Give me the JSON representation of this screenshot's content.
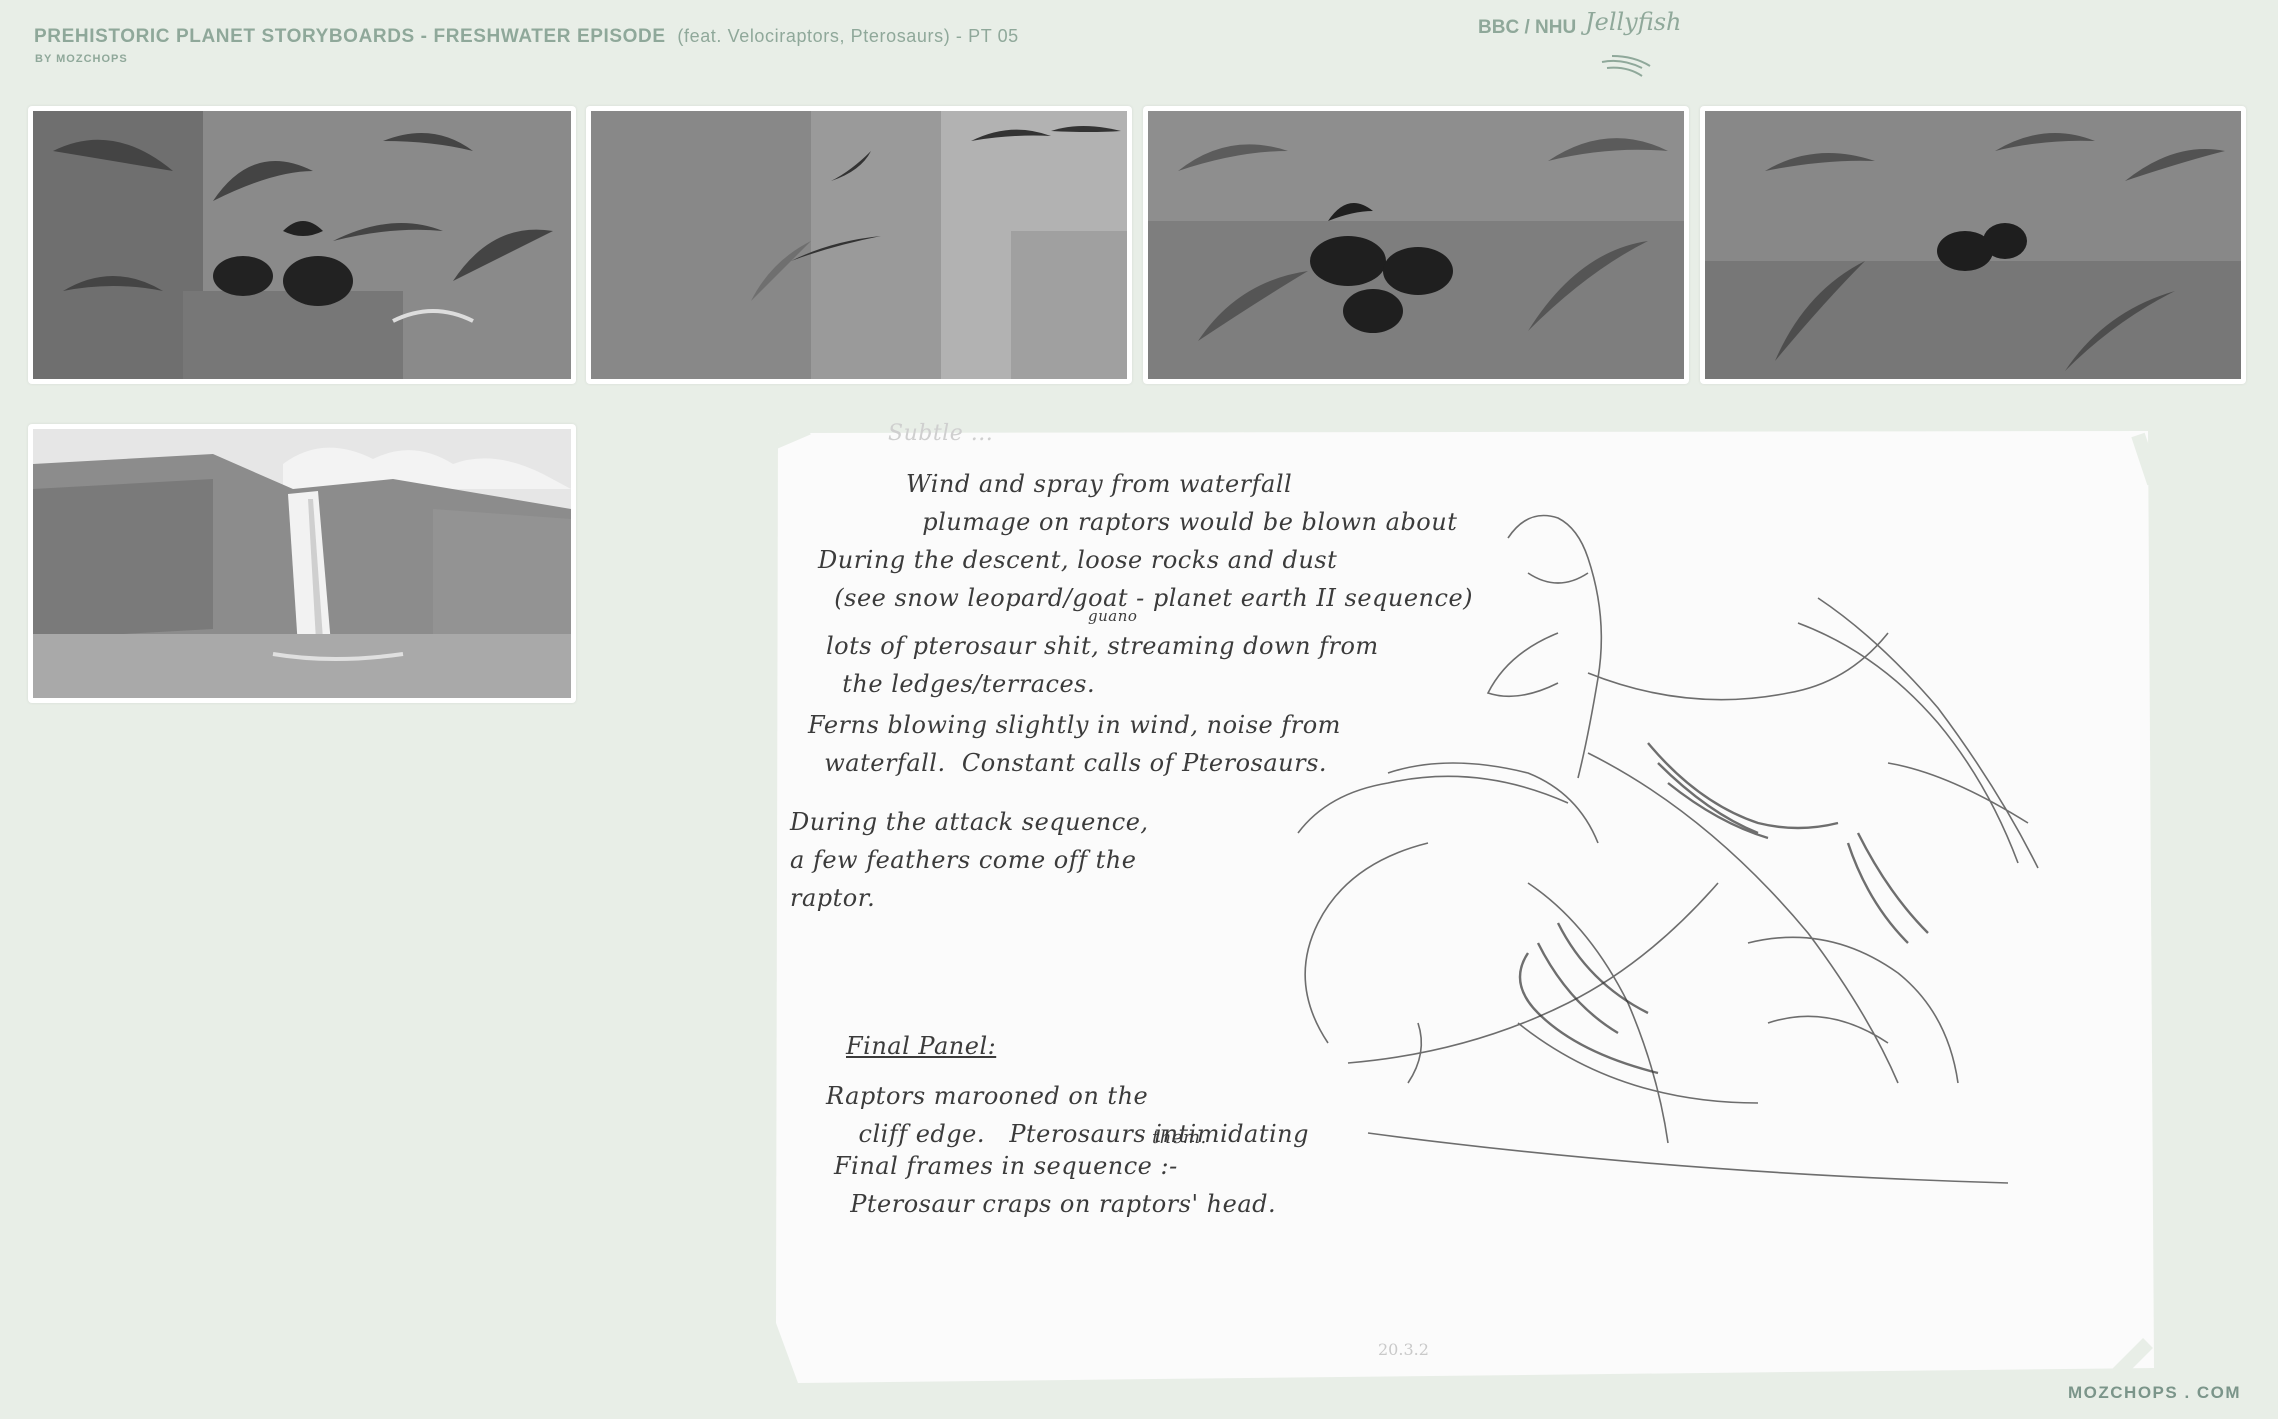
{
  "header": {
    "title": "PREHISTORIC PLANET STORYBOARDS - FRESHWATER EPISODE",
    "subtitle": "(feat. Velociraptors, Pterosaurs) - PT 05",
    "byline": "BY MOZCHOPS",
    "client": "BBC / NHU",
    "studio": "Jellyfish"
  },
  "notes": {
    "faint_heading": "Subtle ...",
    "block1": "Wind and spray from waterfall\n  plumage on raptors would be blown about",
    "block2": "During the descent, loose rocks and dust\n  (see snow leopard/goat - planet earth II sequence)",
    "guano": "guano",
    "block3": "lots of pterosaur shit, streaming down from\n  the ledges/terraces.",
    "block4": "Ferns blowing slightly in wind, noise from\n  waterfall.  Constant calls of Pterosaurs.",
    "block5": "During the attack sequence,\na few feathers come off the\nraptor.",
    "final_heading": "Final Panel:",
    "block6": "Raptors marooned on the\n    cliff edge.   Pterosaurs intimidating",
    "them": "them.",
    "block7": "Final frames in sequence :-\n  Pterosaur craps on raptors' head.",
    "signature": "20.3.2"
  },
  "footer": "MOZCHOPS . COM"
}
